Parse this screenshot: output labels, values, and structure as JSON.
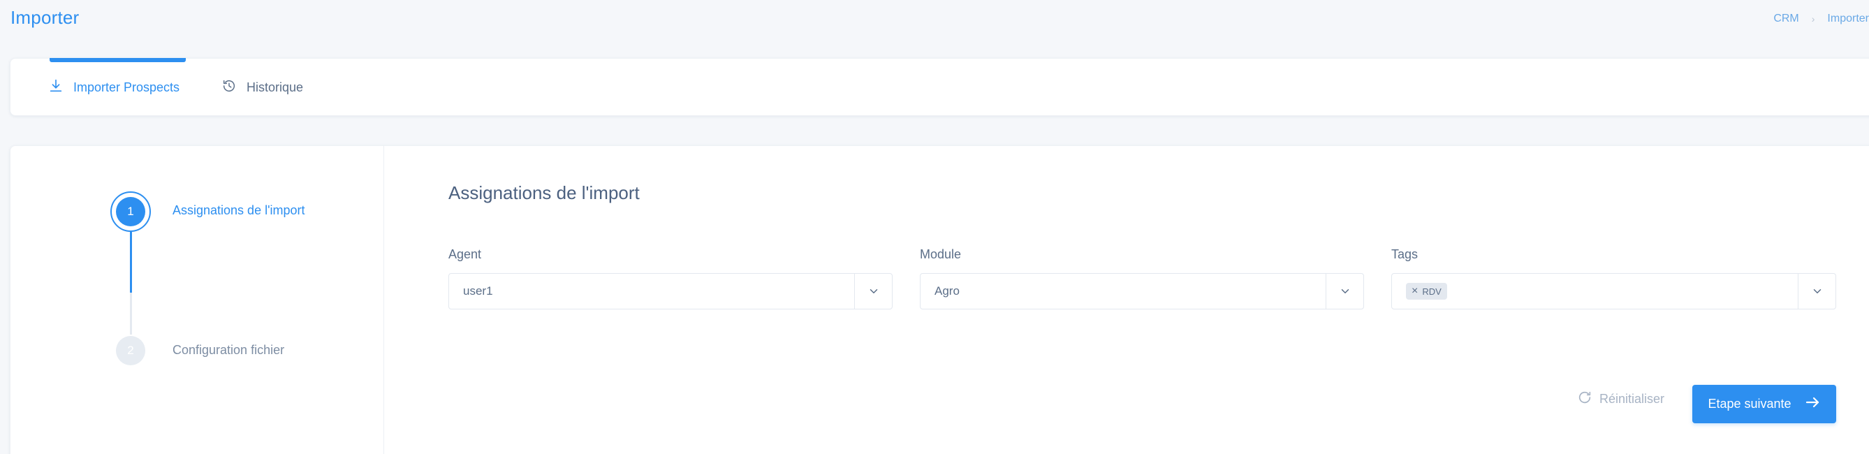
{
  "header": {
    "title": "Importer",
    "breadcrumb": [
      "CRM",
      "Importer"
    ]
  },
  "tabs": [
    {
      "label": "Importer Prospects",
      "icon": "download-icon",
      "active": true
    },
    {
      "label": "Historique",
      "icon": "history-icon",
      "active": false
    }
  ],
  "stepper": {
    "steps": [
      {
        "number": "1",
        "label": "Assignations de l'import",
        "active": true
      },
      {
        "number": "2",
        "label": "Configuration fichier",
        "active": false
      }
    ]
  },
  "form": {
    "title": "Assignations de l'import",
    "agent": {
      "label": "Agent",
      "value": "user1"
    },
    "module": {
      "label": "Module",
      "value": "Agro"
    },
    "tags": {
      "label": "Tags",
      "selected": [
        "RDV"
      ]
    }
  },
  "actions": {
    "reset_label": "Réinitialiser",
    "next_label": "Etape suivante"
  },
  "colors": {
    "accent": "#2d8ff0",
    "text": "#5b6e88",
    "muted": "#a7b3c4"
  }
}
